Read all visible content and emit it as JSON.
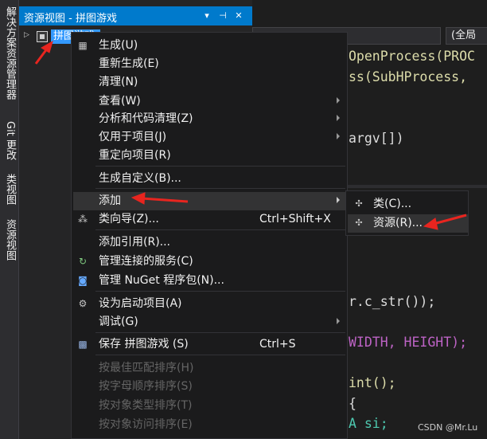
{
  "left_strip": {
    "tabs": [
      "解决方案资源管理器",
      "Git 更改",
      "类视图",
      "资源视图"
    ]
  },
  "panel": {
    "title": "资源视图 - 拼图游戏",
    "tree_root_label": "拼图游戏",
    "title_icons": [
      "dropdown-icon",
      "pin-icon",
      "close-icon"
    ]
  },
  "editor": {
    "nav_right": "(全局",
    "code_lines": [
      {
        "text": "OpenProcess(PROC",
        "color": "#dcdcaa"
      },
      {
        "text": "ss(SubHProcess, ",
        "color": "#dcdcaa"
      },
      {
        "text": "argv[])",
        "color": "#dcdcdc"
      },
      {
        "text": "r.c_str());",
        "color": "#dcdcdc"
      },
      {
        "text": "WIDTH, HEIGHT);",
        "color": "#bd63c5"
      },
      {
        "text": "int();",
        "color": "#dcdcaa"
      },
      {
        "text": "{",
        "color": "#dcdcdc"
      },
      {
        "text": "A si;",
        "color": "#4ec9b0"
      }
    ],
    "watermark": "CSDN @Mr.Lu"
  },
  "menu": {
    "items": [
      {
        "label": "生成(U)",
        "icon": "build-icon"
      },
      {
        "label": "重新生成(E)"
      },
      {
        "label": "清理(N)"
      },
      {
        "label": "查看(W)",
        "submenu": true
      },
      {
        "label": "分析和代码清理(Z)",
        "submenu": true
      },
      {
        "label": "仅用于项目(J)",
        "submenu": true
      },
      {
        "label": "重定向项目(R)"
      },
      {
        "label": "生成自定义(B)..."
      },
      {
        "label": "添加",
        "submenu": true,
        "highlighted": true
      },
      {
        "label": "类向导(Z)...",
        "shortcut": "Ctrl+Shift+X",
        "icon": "class-wizard-icon"
      },
      {
        "label": "添加引用(R)..."
      },
      {
        "label": "管理连接的服务(C)",
        "icon": "connected-services-icon"
      },
      {
        "label": "管理 NuGet 程序包(N)...",
        "icon": "nuget-icon"
      },
      {
        "label": "设为启动项目(A)",
        "icon": "gear-icon"
      },
      {
        "label": "调试(G)",
        "submenu": true
      },
      {
        "label": "保存 拼图游戏 (S)",
        "shortcut": "Ctrl+S",
        "icon": "save-icon"
      },
      {
        "label": "按最佳匹配排序(H)",
        "disabled": true
      },
      {
        "label": "按字母顺序排序(S)",
        "disabled": true
      },
      {
        "label": "按对象类型排序(T)",
        "disabled": true
      },
      {
        "label": "按对象访问排序(E)",
        "disabled": true
      }
    ]
  },
  "submenu": {
    "items": [
      {
        "label": "类(C)...",
        "icon": "add-class-icon"
      },
      {
        "label": "资源(R)...",
        "icon": "add-resource-icon",
        "highlighted": true
      }
    ]
  },
  "colors": {
    "accent": "#007acc",
    "selection": "#3399ff",
    "annotation": "#e8251f"
  }
}
